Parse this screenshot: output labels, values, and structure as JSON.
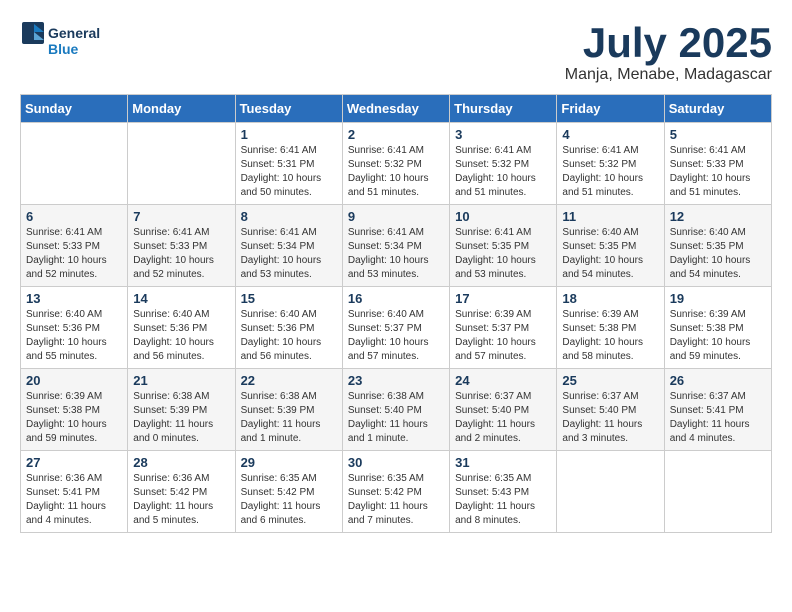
{
  "header": {
    "logo_line1": "General",
    "logo_line2": "Blue",
    "month": "July 2025",
    "location": "Manja, Menabe, Madagascar"
  },
  "weekdays": [
    "Sunday",
    "Monday",
    "Tuesday",
    "Wednesday",
    "Thursday",
    "Friday",
    "Saturday"
  ],
  "weeks": [
    [
      {
        "day": "",
        "info": ""
      },
      {
        "day": "",
        "info": ""
      },
      {
        "day": "1",
        "info": "Sunrise: 6:41 AM\nSunset: 5:31 PM\nDaylight: 10 hours\nand 50 minutes."
      },
      {
        "day": "2",
        "info": "Sunrise: 6:41 AM\nSunset: 5:32 PM\nDaylight: 10 hours\nand 51 minutes."
      },
      {
        "day": "3",
        "info": "Sunrise: 6:41 AM\nSunset: 5:32 PM\nDaylight: 10 hours\nand 51 minutes."
      },
      {
        "day": "4",
        "info": "Sunrise: 6:41 AM\nSunset: 5:32 PM\nDaylight: 10 hours\nand 51 minutes."
      },
      {
        "day": "5",
        "info": "Sunrise: 6:41 AM\nSunset: 5:33 PM\nDaylight: 10 hours\nand 51 minutes."
      }
    ],
    [
      {
        "day": "6",
        "info": "Sunrise: 6:41 AM\nSunset: 5:33 PM\nDaylight: 10 hours\nand 52 minutes."
      },
      {
        "day": "7",
        "info": "Sunrise: 6:41 AM\nSunset: 5:33 PM\nDaylight: 10 hours\nand 52 minutes."
      },
      {
        "day": "8",
        "info": "Sunrise: 6:41 AM\nSunset: 5:34 PM\nDaylight: 10 hours\nand 53 minutes."
      },
      {
        "day": "9",
        "info": "Sunrise: 6:41 AM\nSunset: 5:34 PM\nDaylight: 10 hours\nand 53 minutes."
      },
      {
        "day": "10",
        "info": "Sunrise: 6:41 AM\nSunset: 5:35 PM\nDaylight: 10 hours\nand 53 minutes."
      },
      {
        "day": "11",
        "info": "Sunrise: 6:40 AM\nSunset: 5:35 PM\nDaylight: 10 hours\nand 54 minutes."
      },
      {
        "day": "12",
        "info": "Sunrise: 6:40 AM\nSunset: 5:35 PM\nDaylight: 10 hours\nand 54 minutes."
      }
    ],
    [
      {
        "day": "13",
        "info": "Sunrise: 6:40 AM\nSunset: 5:36 PM\nDaylight: 10 hours\nand 55 minutes."
      },
      {
        "day": "14",
        "info": "Sunrise: 6:40 AM\nSunset: 5:36 PM\nDaylight: 10 hours\nand 56 minutes."
      },
      {
        "day": "15",
        "info": "Sunrise: 6:40 AM\nSunset: 5:36 PM\nDaylight: 10 hours\nand 56 minutes."
      },
      {
        "day": "16",
        "info": "Sunrise: 6:40 AM\nSunset: 5:37 PM\nDaylight: 10 hours\nand 57 minutes."
      },
      {
        "day": "17",
        "info": "Sunrise: 6:39 AM\nSunset: 5:37 PM\nDaylight: 10 hours\nand 57 minutes."
      },
      {
        "day": "18",
        "info": "Sunrise: 6:39 AM\nSunset: 5:38 PM\nDaylight: 10 hours\nand 58 minutes."
      },
      {
        "day": "19",
        "info": "Sunrise: 6:39 AM\nSunset: 5:38 PM\nDaylight: 10 hours\nand 59 minutes."
      }
    ],
    [
      {
        "day": "20",
        "info": "Sunrise: 6:39 AM\nSunset: 5:38 PM\nDaylight: 10 hours\nand 59 minutes."
      },
      {
        "day": "21",
        "info": "Sunrise: 6:38 AM\nSunset: 5:39 PM\nDaylight: 11 hours\nand 0 minutes."
      },
      {
        "day": "22",
        "info": "Sunrise: 6:38 AM\nSunset: 5:39 PM\nDaylight: 11 hours\nand 1 minute."
      },
      {
        "day": "23",
        "info": "Sunrise: 6:38 AM\nSunset: 5:40 PM\nDaylight: 11 hours\nand 1 minute."
      },
      {
        "day": "24",
        "info": "Sunrise: 6:37 AM\nSunset: 5:40 PM\nDaylight: 11 hours\nand 2 minutes."
      },
      {
        "day": "25",
        "info": "Sunrise: 6:37 AM\nSunset: 5:40 PM\nDaylight: 11 hours\nand 3 minutes."
      },
      {
        "day": "26",
        "info": "Sunrise: 6:37 AM\nSunset: 5:41 PM\nDaylight: 11 hours\nand 4 minutes."
      }
    ],
    [
      {
        "day": "27",
        "info": "Sunrise: 6:36 AM\nSunset: 5:41 PM\nDaylight: 11 hours\nand 4 minutes."
      },
      {
        "day": "28",
        "info": "Sunrise: 6:36 AM\nSunset: 5:42 PM\nDaylight: 11 hours\nand 5 minutes."
      },
      {
        "day": "29",
        "info": "Sunrise: 6:35 AM\nSunset: 5:42 PM\nDaylight: 11 hours\nand 6 minutes."
      },
      {
        "day": "30",
        "info": "Sunrise: 6:35 AM\nSunset: 5:42 PM\nDaylight: 11 hours\nand 7 minutes."
      },
      {
        "day": "31",
        "info": "Sunrise: 6:35 AM\nSunset: 5:43 PM\nDaylight: 11 hours\nand 8 minutes."
      },
      {
        "day": "",
        "info": ""
      },
      {
        "day": "",
        "info": ""
      }
    ]
  ]
}
